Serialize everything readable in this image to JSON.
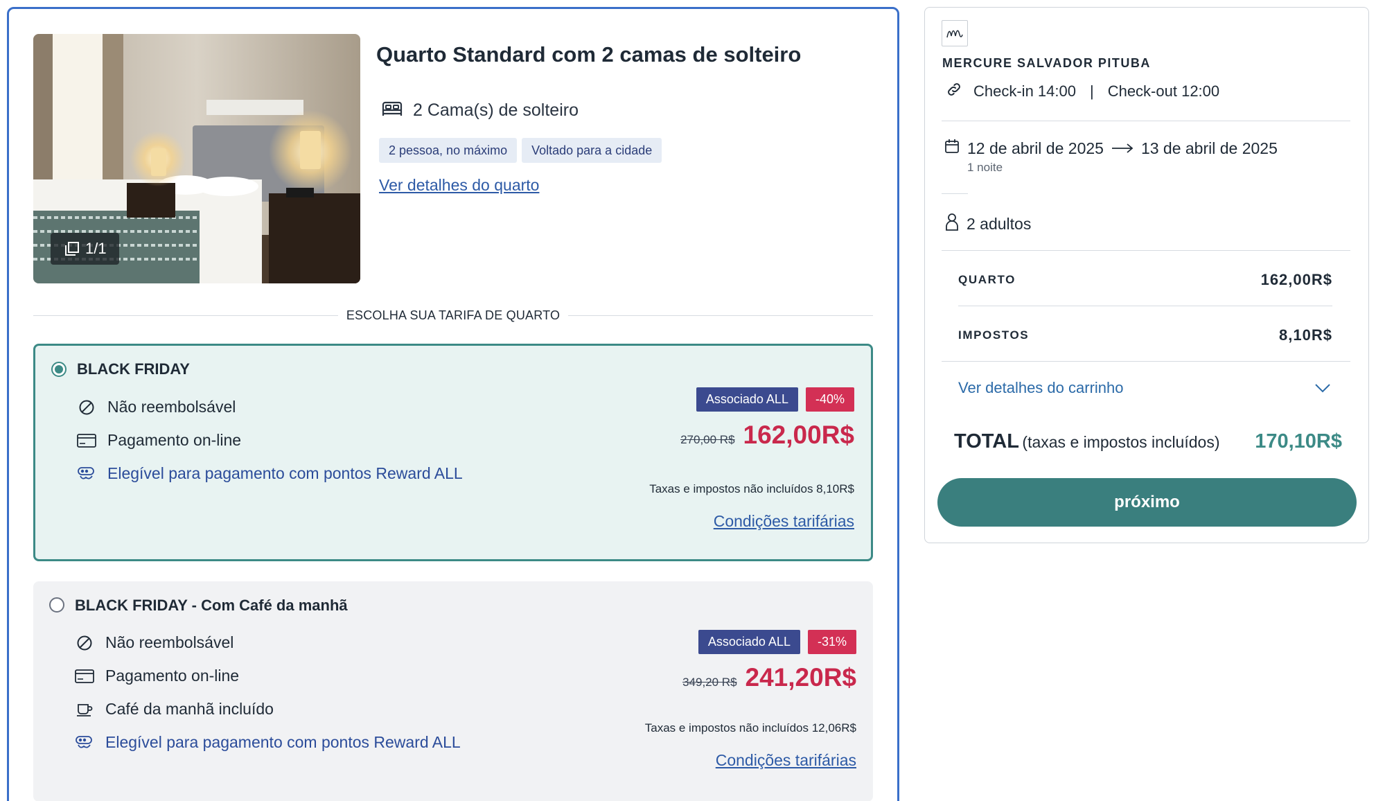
{
  "room": {
    "title": "Quarto Standard com 2 camas de solteiro",
    "photo_counter": "1/1",
    "beds": "2 Cama(s) de solteiro",
    "tags": [
      "2 pessoa, no máximo",
      "Voltado para a cidade"
    ],
    "details_link": "Ver detalhes do quarto",
    "rate_section_label": "ESCOLHA SUA TARIFA DE QUARTO"
  },
  "rates": [
    {
      "name": "BLACK FRIDAY",
      "selected": true,
      "features": [
        {
          "icon": "no-refund-icon",
          "text": "Não reembolsável"
        },
        {
          "icon": "credit-card-icon",
          "text": "Pagamento on-line"
        },
        {
          "icon": "reward-points-icon",
          "text": "Elegível para pagamento com pontos Reward ALL"
        }
      ],
      "member_badge": "Associado ALL",
      "discount_badge": "-40%",
      "old_price": "270,00 R$",
      "price": "162,00R$",
      "tax_note": "Taxas e impostos não incluídos 8,10R$",
      "conditions_link": "Condições tarifárias"
    },
    {
      "name": "BLACK FRIDAY - Com Café da manhã",
      "selected": false,
      "features": [
        {
          "icon": "no-refund-icon",
          "text": "Não reembolsável"
        },
        {
          "icon": "credit-card-icon",
          "text": "Pagamento on-line"
        },
        {
          "icon": "coffee-cup-icon",
          "text": "Café da manhã incluído"
        },
        {
          "icon": "reward-points-icon",
          "text": "Elegível para pagamento com pontos Reward ALL"
        }
      ],
      "member_badge": "Associado ALL",
      "discount_badge": "-31%",
      "old_price": "349,20 R$",
      "price": "241,20R$",
      "tax_note": "Taxas e impostos não incluídos 12,06R$",
      "conditions_link": "Condições tarifárias"
    }
  ],
  "summary": {
    "hotel_name": "MERCURE SALVADOR PITUBA",
    "check_in": "Check-in 14:00",
    "separator": "|",
    "check_out": "Check-out 12:00",
    "date_from": "12 de abril de 2025",
    "date_to": "13 de abril de 2025",
    "nights": "1 noite",
    "guests": "2 adultos",
    "room_label": "QUARTO",
    "room_value": "162,00R$",
    "taxes_label": "IMPOSTOS",
    "taxes_value": "8,10R$",
    "cart_details": "Ver detalhes do carrinho",
    "total_label": "TOTAL",
    "total_sub": "(taxas e impostos incluídos)",
    "total_value": "170,10R$",
    "next_button": "próximo"
  },
  "colors": {
    "accent_teal": "#3a7f7e",
    "price_red": "#c9284c",
    "member_badge": "#3b4a8f",
    "discount_badge": "#d33055",
    "link_blue": "#2d5aa6"
  }
}
